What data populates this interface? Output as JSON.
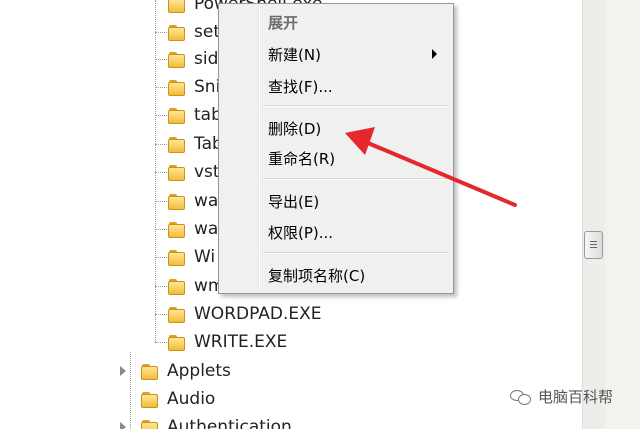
{
  "tree": {
    "items": [
      {
        "label": "PowerShell.exe"
      },
      {
        "label": "set"
      },
      {
        "label": "sid"
      },
      {
        "label": "Sni"
      },
      {
        "label": "tab"
      },
      {
        "label": "Tab"
      },
      {
        "label": "vst"
      },
      {
        "label": "wa"
      },
      {
        "label": "wa"
      },
      {
        "label": "Wi"
      },
      {
        "label": "wm"
      },
      {
        "label": "WORDPAD.EXE"
      },
      {
        "label": "WRITE.EXE"
      },
      {
        "label": "Applets"
      },
      {
        "label": "Audio"
      },
      {
        "label": "Authentication"
      }
    ]
  },
  "context_menu": {
    "items": [
      {
        "label": "展开"
      },
      {
        "label": "新建(N)"
      },
      {
        "label": "查找(F)..."
      },
      {
        "label": "删除(D)"
      },
      {
        "label": "重命名(R)"
      },
      {
        "label": "导出(E)"
      },
      {
        "label": "权限(P)..."
      },
      {
        "label": "复制项名称(C)"
      }
    ]
  },
  "annotation": {
    "arrow_color": "#e5282d"
  },
  "watermark": {
    "text": "电脑百科帮"
  },
  "colors": {
    "folder": "#f2bd39",
    "menu_bg": "#f0f0f0"
  }
}
